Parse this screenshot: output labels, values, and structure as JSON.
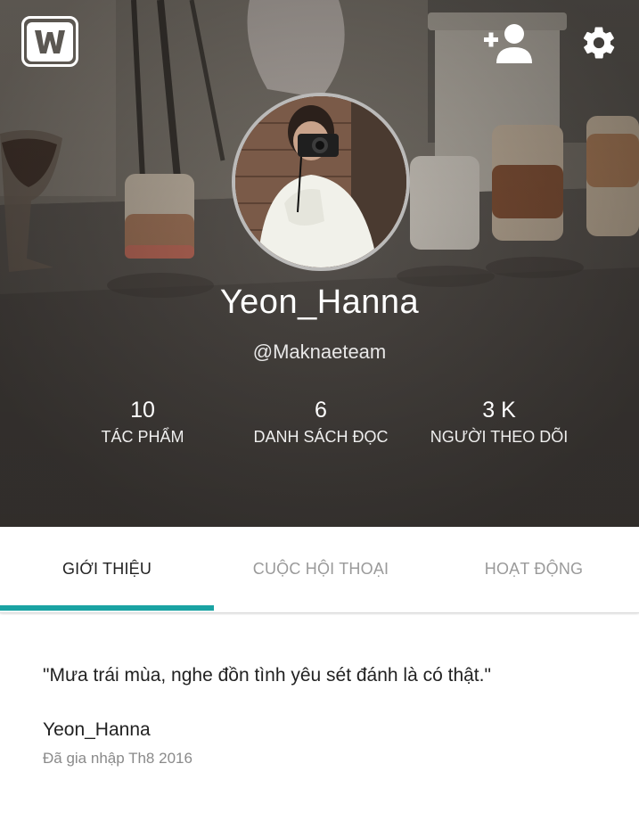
{
  "header": {
    "logo_icon": "wattpad-logo-icon",
    "add_friend_icon": "add-person-icon",
    "settings_icon": "gear-icon"
  },
  "profile": {
    "display_name": "Yeon_Hanna",
    "handle": "@Maknaeteam",
    "stats": [
      {
        "value": "10",
        "label": "TÁC PHẨM"
      },
      {
        "value": "6",
        "label": "DANH SÁCH ĐỌC"
      },
      {
        "value": "3 K",
        "label": "NGƯỜI THEO DÕI"
      }
    ]
  },
  "tabs": [
    {
      "label": "GIỚI THIỆU",
      "active": true
    },
    {
      "label": "CUỘC HỘI THOẠI",
      "active": false
    },
    {
      "label": "HOẠT ĐỘNG",
      "active": false
    }
  ],
  "about": {
    "quote": "\"Mưa trái mùa, nghe đồn tình yêu sét đánh là có thật.\"",
    "name": "Yeon_Hanna",
    "joined": "Đã gia nhập Th8 2016"
  },
  "colors": {
    "accent": "#1aa3a3",
    "active_tab_text": "#222222",
    "inactive_tab_text": "#9a9a9a"
  }
}
